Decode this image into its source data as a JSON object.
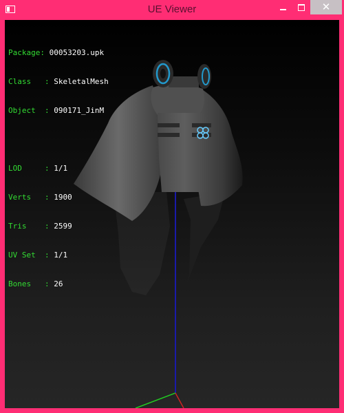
{
  "window": {
    "title": "UE Viewer",
    "close_glyph": "✕",
    "frame_color": "#ff2d74"
  },
  "info": {
    "package": {
      "label": "Package: ",
      "value": "00053203.upk"
    },
    "class": {
      "label": "Class   : ",
      "value": "SkeletalMesh"
    },
    "object": {
      "label": "Object  : ",
      "value": "090171_JinM"
    },
    "lod": {
      "label": "LOD     : ",
      "value": "1/1"
    },
    "verts": {
      "label": "Verts   : ",
      "value": "1900"
    },
    "tris": {
      "label": "Tris    : ",
      "value": "2599"
    },
    "uvset": {
      "label": "UV Set  : ",
      "value": "1/1"
    },
    "bones": {
      "label": "Bones   : ",
      "value": "26"
    },
    "label_color": "#33dd33",
    "value_color": "#ffffff"
  },
  "icons": {
    "app": "app-window-icon",
    "minimize": "minimize-icon",
    "maximize": "maximize-icon",
    "close": "close-icon"
  }
}
